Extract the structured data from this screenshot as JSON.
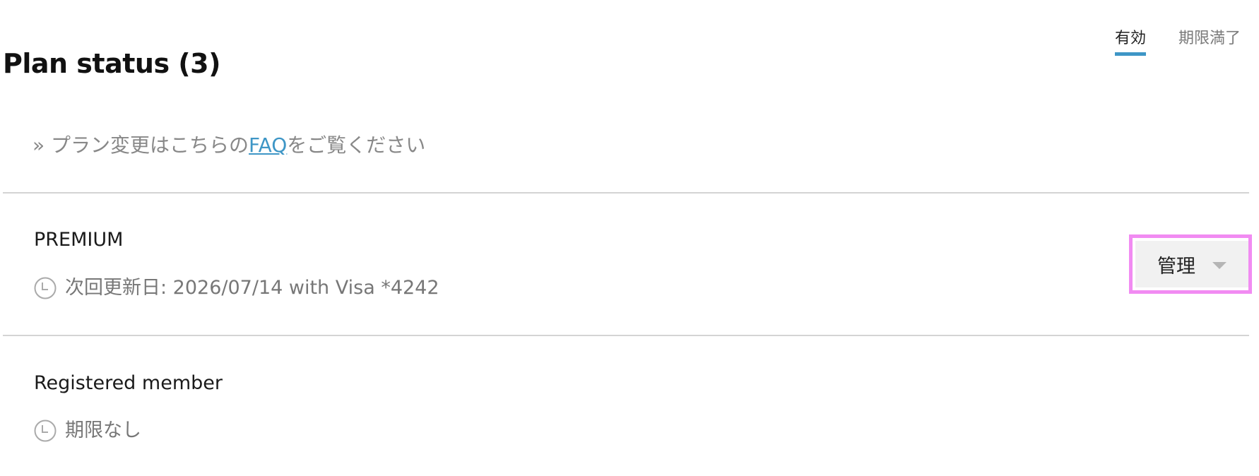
{
  "header": {
    "title": "Plan status (3)"
  },
  "tabs": [
    {
      "label": "有効",
      "active": true
    },
    {
      "label": "期限満了",
      "active": false
    }
  ],
  "faq_note": {
    "prefix": "» プラン変更はこちらの",
    "link_text": "FAQ",
    "suffix": "をご覧ください"
  },
  "plans": [
    {
      "name": "PREMIUM",
      "meta": "次回更新日: 2026/07/14 with Visa *4242",
      "meta_icon": "clock-icon",
      "action_label": "管理",
      "action_icon": "caret-down-icon"
    },
    {
      "name": "Registered member",
      "meta": "期限なし",
      "meta_icon": "clock-icon"
    }
  ],
  "colors": {
    "accent": "#3e96c6",
    "highlight": "#f18bf2",
    "divider": "#d4d4d4",
    "muted_text": "#777777"
  }
}
